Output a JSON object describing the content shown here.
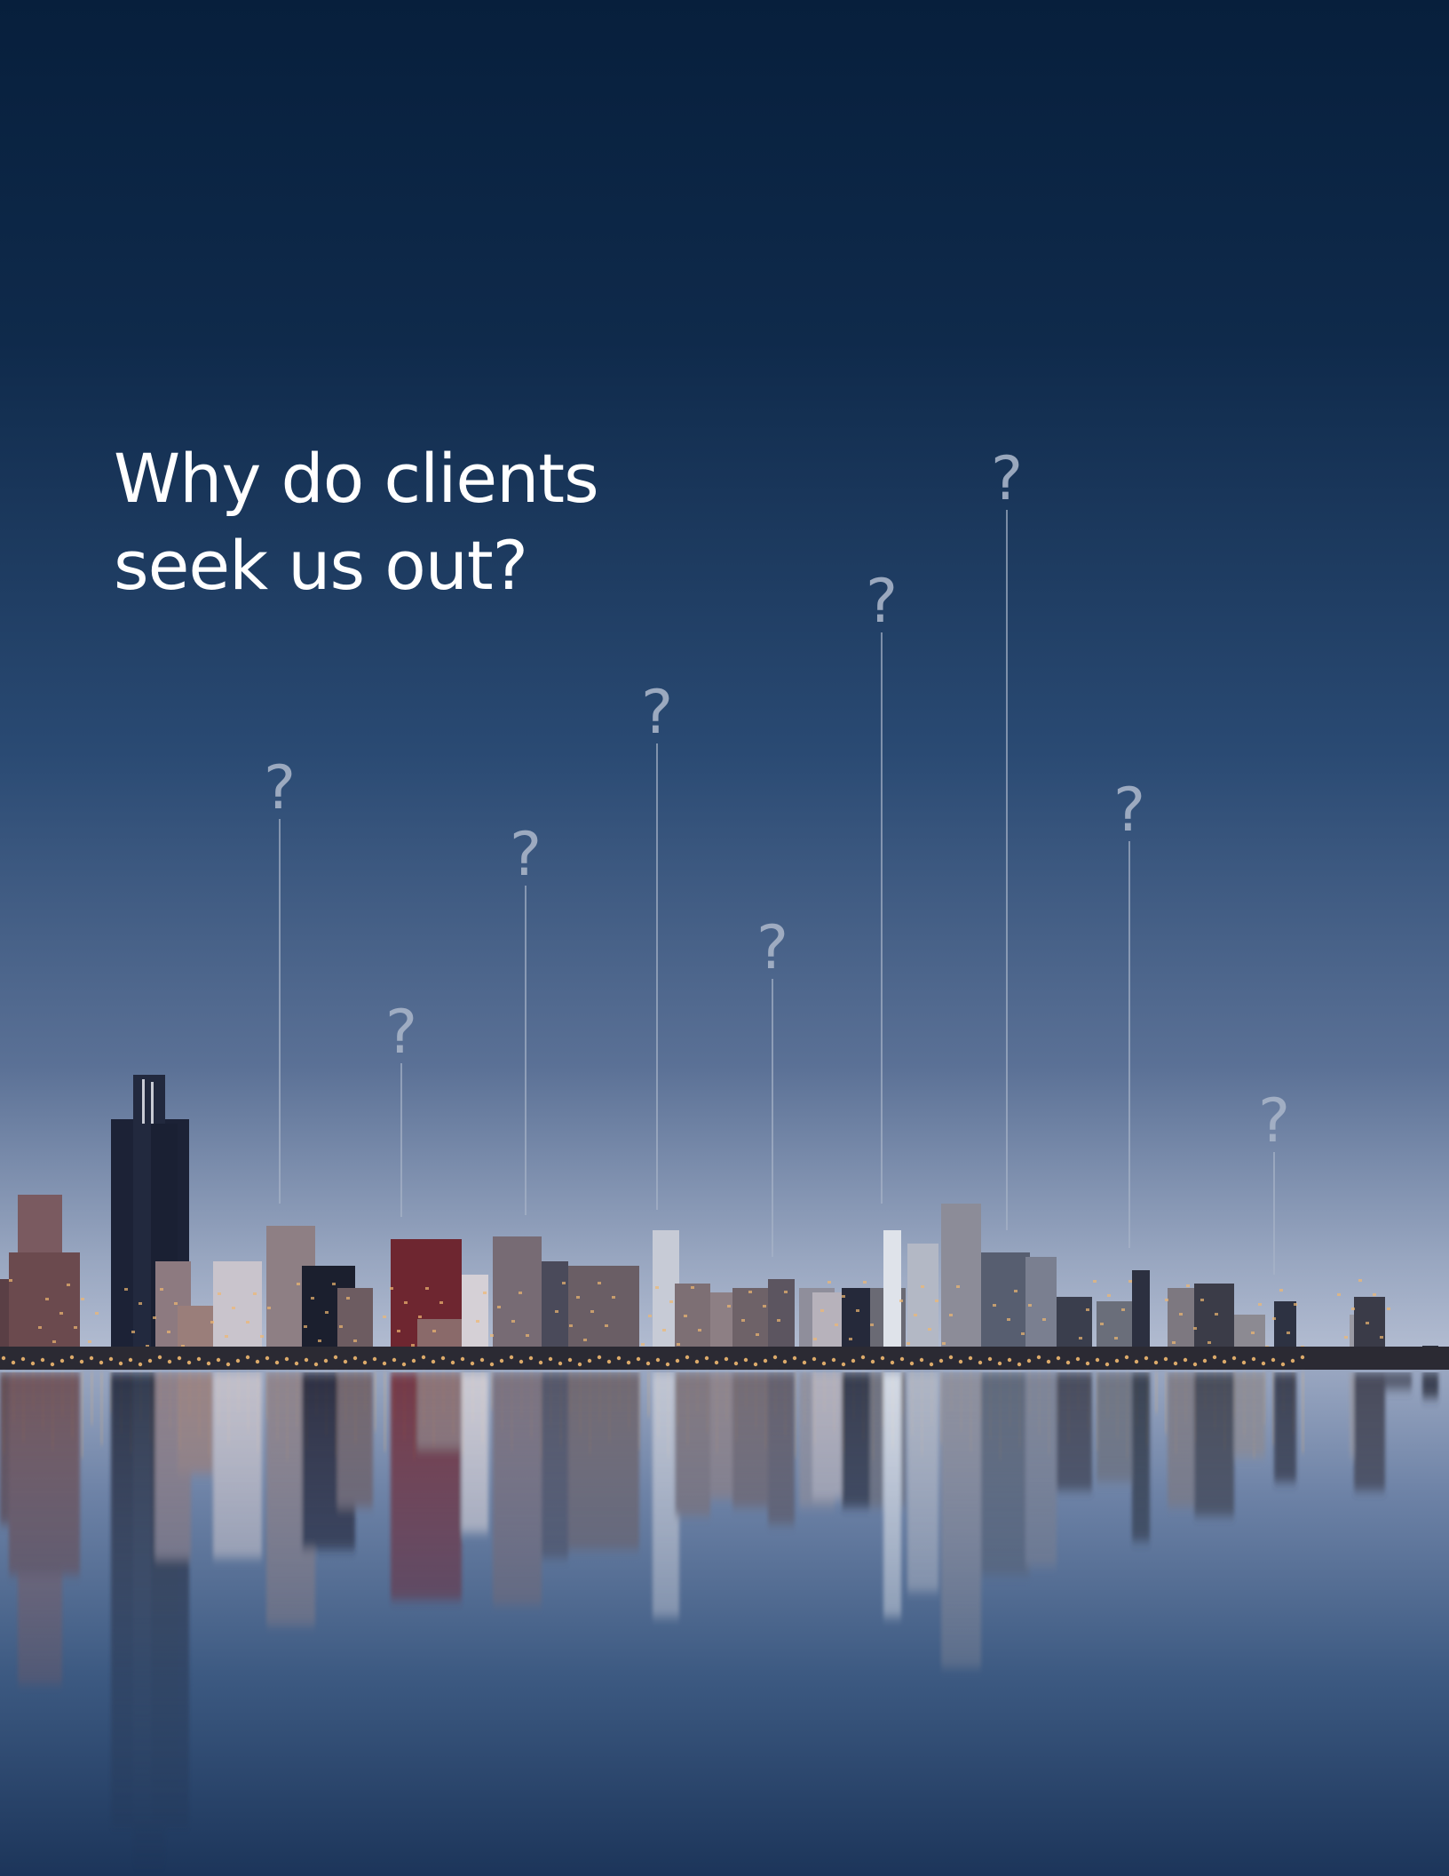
{
  "headline": {
    "line1": "Why do clients",
    "line2": "seek us out?"
  },
  "marker_glyph": "?",
  "marker_count": 10,
  "colors": {
    "sky_top": "#0a2240",
    "sky_mid": "#2b4b74",
    "sky_horizon": "#a8b6cf",
    "water_top": "#8e9fbd",
    "water_bottom": "#1f3a5f",
    "marker": "#a8b4c8",
    "city_lights": "#f0b870"
  },
  "image": {
    "description_icon": "city-skyline-reflection"
  }
}
